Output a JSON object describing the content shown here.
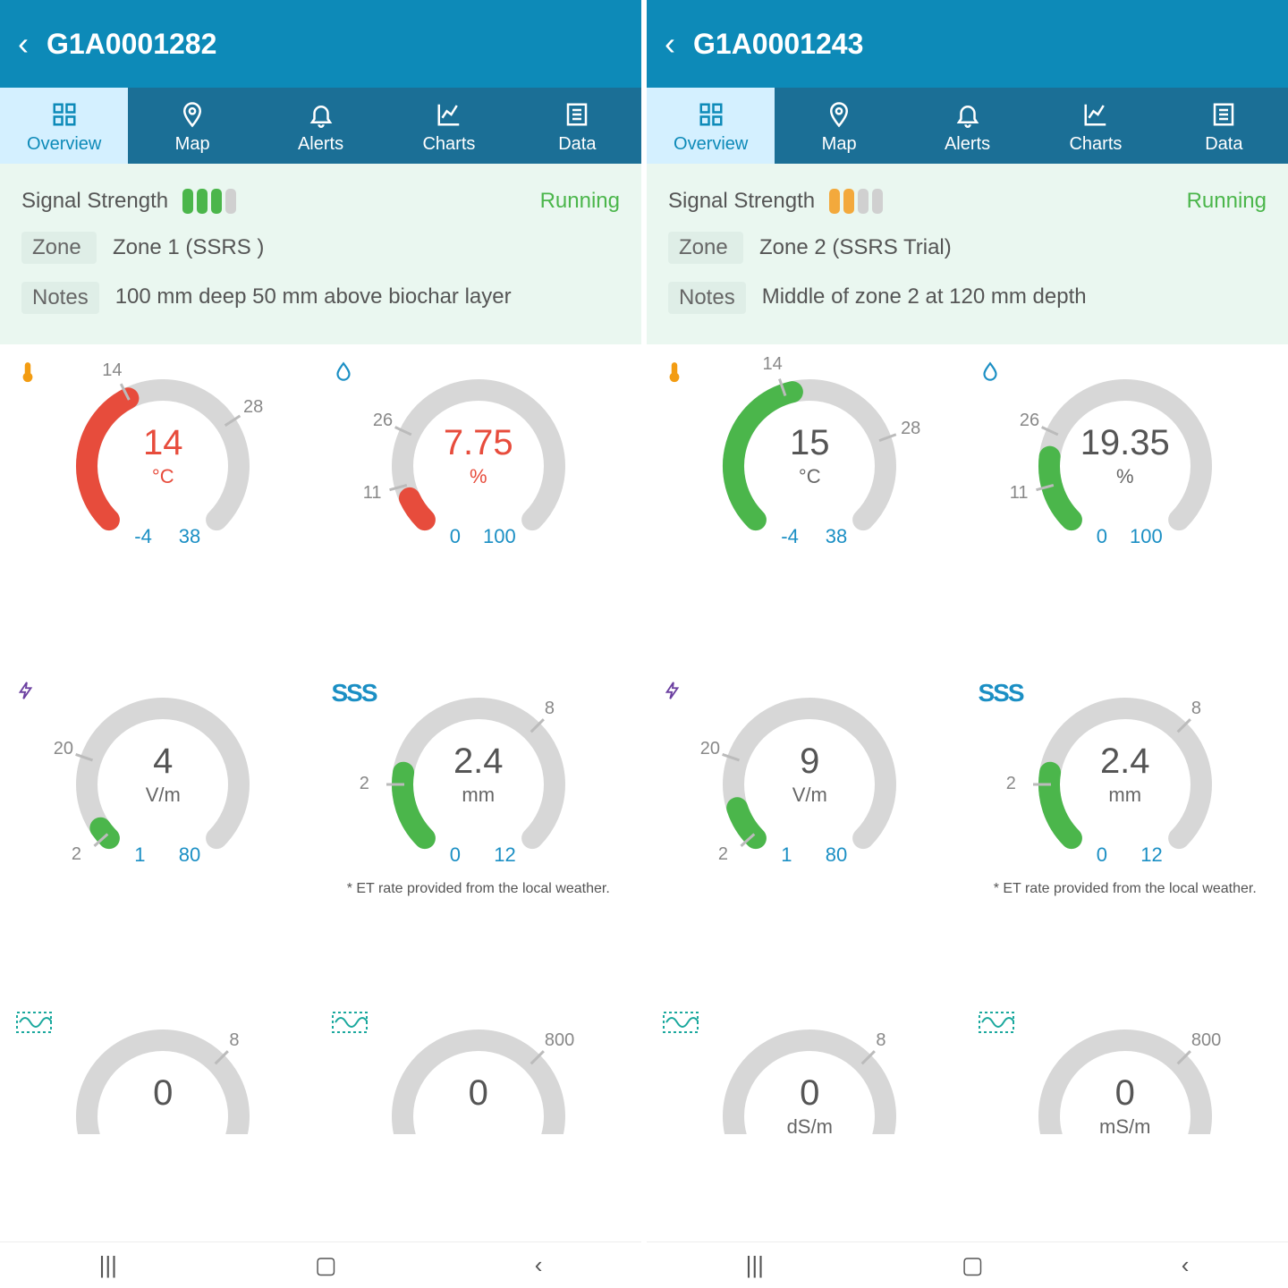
{
  "panels": [
    {
      "device_id": "G1A0001282",
      "tabs": {
        "overview": "Overview",
        "map": "Map",
        "alerts": "Alerts",
        "charts": "Charts",
        "data": "Data"
      },
      "signal": {
        "label": "Signal Strength",
        "bars": [
          "green",
          "green",
          "green",
          "grey"
        ],
        "status": "Running"
      },
      "zone": {
        "label": "Zone",
        "value": "Zone 1 (SSRS )"
      },
      "notes": {
        "label": "Notes",
        "value": "100 mm deep 50 mm above biochar layer"
      },
      "gauges": [
        {
          "icon": "temp",
          "value": "14",
          "unit": "°C",
          "value_color": "red",
          "arc_color": "#e74c3c",
          "min": "-4",
          "max": "38",
          "fill_deg": 108,
          "tick1": {
            "label": "14",
            "deg": 108
          },
          "tick2": {
            "label": "28",
            "deg": 192
          }
        },
        {
          "icon": "water",
          "value": "7.75",
          "unit": "%",
          "value_color": "red",
          "arc_color": "#e74c3c",
          "min": "0",
          "max": "100",
          "fill_deg": 20,
          "tick1": {
            "label": "11",
            "deg": 30
          },
          "tick2": {
            "label": "26",
            "deg": 70
          }
        },
        {
          "icon": "bolt",
          "value": "4",
          "unit": "V/m",
          "value_color": "grey",
          "arc_color": "#4bb64b",
          "min": "1",
          "max": "80",
          "fill_deg": 10,
          "tick1": {
            "label": "2",
            "deg": 3
          },
          "tick2": {
            "label": "20",
            "deg": 64
          }
        },
        {
          "icon": "heat",
          "value": "2.4",
          "unit": "mm",
          "value_color": "grey",
          "arc_color": "#4bb64b",
          "min": "0",
          "max": "12",
          "fill_deg": 54,
          "tick1": {
            "label": "2",
            "deg": 45
          },
          "tick2": {
            "label": "8",
            "deg": 180
          },
          "note": "* ET rate provided from the local weather."
        },
        {
          "icon": "wave",
          "value": "0",
          "unit": "",
          "value_color": "grey",
          "arc_color": "#4bb64b",
          "min": "",
          "max": "",
          "fill_deg": 0,
          "tick1": null,
          "tick2": {
            "label": "8",
            "deg": 180
          },
          "partial": true
        },
        {
          "icon": "wave",
          "value": "0",
          "unit": "",
          "value_color": "grey",
          "arc_color": "#4bb64b",
          "min": "",
          "max": "",
          "fill_deg": 0,
          "tick1": null,
          "tick2": {
            "label": "800",
            "deg": 180
          },
          "partial": true
        }
      ]
    },
    {
      "device_id": "G1A0001243",
      "tabs": {
        "overview": "Overview",
        "map": "Map",
        "alerts": "Alerts",
        "charts": "Charts",
        "data": "Data"
      },
      "signal": {
        "label": "Signal Strength",
        "bars": [
          "orange",
          "orange",
          "grey",
          "grey"
        ],
        "status": "Running"
      },
      "zone": {
        "label": "Zone",
        "value": "Zone 2 (SSRS Trial)"
      },
      "notes": {
        "label": "Notes",
        "value": "Middle of zone 2 at 120 mm depth"
      },
      "gauges": [
        {
          "icon": "temp",
          "value": "15",
          "unit": "°C",
          "value_color": "grey",
          "arc_color": "#4bb64b",
          "min": "-4",
          "max": "38",
          "fill_deg": 122,
          "tick1": {
            "label": "14",
            "deg": 116
          },
          "tick2": {
            "label": "28",
            "deg": 205
          }
        },
        {
          "icon": "water",
          "value": "19.35",
          "unit": "%",
          "value_color": "grey",
          "arc_color": "#4bb64b",
          "min": "0",
          "max": "100",
          "fill_deg": 52,
          "tick1": {
            "label": "11",
            "deg": 30
          },
          "tick2": {
            "label": "26",
            "deg": 70
          }
        },
        {
          "icon": "bolt",
          "value": "9",
          "unit": "V/m",
          "value_color": "grey",
          "arc_color": "#4bb64b",
          "min": "1",
          "max": "80",
          "fill_deg": 27,
          "tick1": {
            "label": "2",
            "deg": 3
          },
          "tick2": {
            "label": "20",
            "deg": 64
          }
        },
        {
          "icon": "heat",
          "value": "2.4",
          "unit": "mm",
          "value_color": "grey",
          "arc_color": "#4bb64b",
          "min": "0",
          "max": "12",
          "fill_deg": 54,
          "tick1": {
            "label": "2",
            "deg": 45
          },
          "tick2": {
            "label": "8",
            "deg": 180
          },
          "note": "* ET rate provided from the local weather."
        },
        {
          "icon": "wave",
          "value": "0",
          "unit": "dS/m",
          "value_color": "grey",
          "arc_color": "#4bb64b",
          "min": "",
          "max": "",
          "fill_deg": 0,
          "tick1": null,
          "tick2": {
            "label": "8",
            "deg": 180
          },
          "partial": true
        },
        {
          "icon": "wave",
          "value": "0",
          "unit": "mS/m",
          "value_color": "grey",
          "arc_color": "#4bb64b",
          "min": "",
          "max": "",
          "fill_deg": 0,
          "tick1": null,
          "tick2": {
            "label": "800",
            "deg": 180
          },
          "partial": true
        }
      ]
    }
  ],
  "chart_data": [
    {
      "device": "G1A0001282",
      "gauges": [
        {
          "type": "gauge",
          "label": "Temperature",
          "value": 14,
          "unit": "°C",
          "range": [
            -4,
            38
          ],
          "ticks": [
            14,
            28
          ],
          "status": "red"
        },
        {
          "type": "gauge",
          "label": "Moisture",
          "value": 7.75,
          "unit": "%",
          "range": [
            0,
            100
          ],
          "ticks": [
            11,
            26
          ],
          "status": "red"
        },
        {
          "type": "gauge",
          "label": "Voltage",
          "value": 4,
          "unit": "V/m",
          "range": [
            1,
            80
          ],
          "ticks": [
            2,
            20
          ],
          "status": "green"
        },
        {
          "type": "gauge",
          "label": "ET",
          "value": 2.4,
          "unit": "mm",
          "range": [
            0,
            12
          ],
          "ticks": [
            2,
            8
          ],
          "status": "green"
        },
        {
          "type": "gauge",
          "label": "Salinity1",
          "value": 0,
          "unit": "",
          "range": [
            0,
            8
          ],
          "status": "grey"
        },
        {
          "type": "gauge",
          "label": "Salinity2",
          "value": 0,
          "unit": "",
          "range": [
            0,
            800
          ],
          "status": "grey"
        }
      ]
    },
    {
      "device": "G1A0001243",
      "gauges": [
        {
          "type": "gauge",
          "label": "Temperature",
          "value": 15,
          "unit": "°C",
          "range": [
            -4,
            38
          ],
          "ticks": [
            14,
            28
          ],
          "status": "green"
        },
        {
          "type": "gauge",
          "label": "Moisture",
          "value": 19.35,
          "unit": "%",
          "range": [
            0,
            100
          ],
          "ticks": [
            11,
            26
          ],
          "status": "green"
        },
        {
          "type": "gauge",
          "label": "Voltage",
          "value": 9,
          "unit": "V/m",
          "range": [
            1,
            80
          ],
          "ticks": [
            2,
            20
          ],
          "status": "green"
        },
        {
          "type": "gauge",
          "label": "ET",
          "value": 2.4,
          "unit": "mm",
          "range": [
            0,
            12
          ],
          "ticks": [
            2,
            8
          ],
          "status": "green"
        },
        {
          "type": "gauge",
          "label": "Salinity1",
          "value": 0,
          "unit": "dS/m",
          "range": [
            0,
            8
          ],
          "status": "grey"
        },
        {
          "type": "gauge",
          "label": "Salinity2",
          "value": 0,
          "unit": "mS/m",
          "range": [
            0,
            800
          ],
          "status": "grey"
        }
      ]
    }
  ]
}
